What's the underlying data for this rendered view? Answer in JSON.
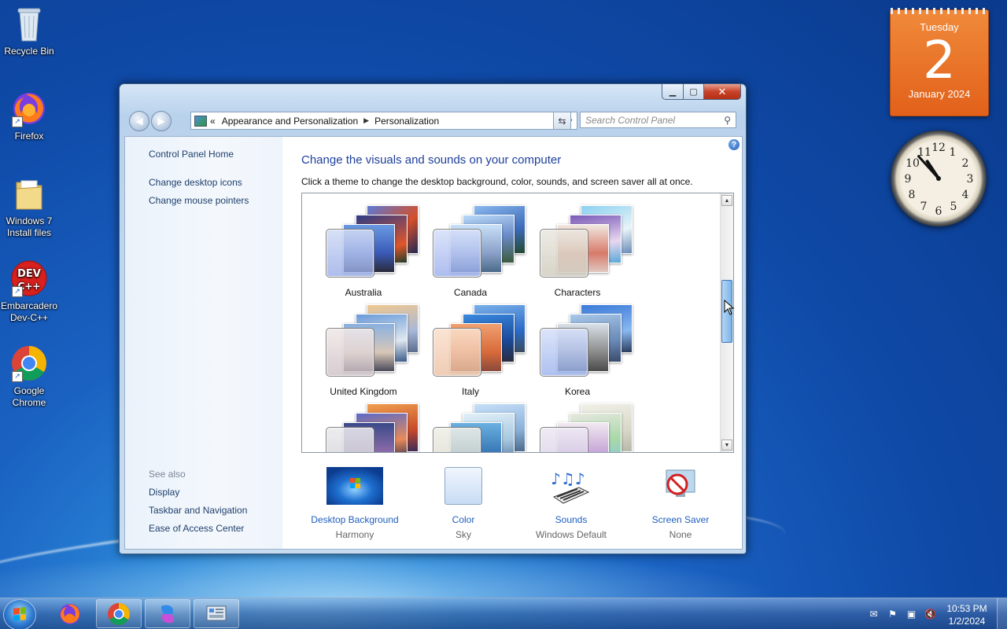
{
  "desktop": {
    "icons": [
      {
        "label": "Recycle Bin"
      },
      {
        "label": "Firefox"
      },
      {
        "label": "Windows 7 Install files"
      },
      {
        "label": "Embarcadero Dev-C++"
      },
      {
        "label": "Google Chrome"
      }
    ]
  },
  "calendar": {
    "day_of_week": "Tuesday",
    "day": "2",
    "month_year": "January 2024"
  },
  "clock": {
    "hour": 10,
    "minute": 53
  },
  "window": {
    "breadcrumb": {
      "prefix": "«",
      "items": [
        "Appearance and Personalization",
        "Personalization"
      ]
    },
    "search_placeholder": "Search Control Panel",
    "left_pane": {
      "home": "Control Panel Home",
      "links": [
        "Change desktop icons",
        "Change mouse pointers"
      ],
      "see_also_label": "See also",
      "see_also": [
        "Display",
        "Taskbar and Navigation",
        "Ease of Access Center"
      ]
    },
    "heading": "Change the visuals and sounds on your computer",
    "subtext": "Click a theme to change the desktop background, color, sounds, and screen saver all at once.",
    "themes": [
      {
        "name": "Australia"
      },
      {
        "name": "Canada"
      },
      {
        "name": "Characters"
      },
      {
        "name": "United Kingdom"
      },
      {
        "name": "Italy"
      },
      {
        "name": "Korea"
      },
      {
        "name": ""
      },
      {
        "name": ""
      },
      {
        "name": ""
      }
    ],
    "bottom": [
      {
        "label": "Desktop Background",
        "value": "Harmony"
      },
      {
        "label": "Color",
        "value": "Sky"
      },
      {
        "label": "Sounds",
        "value": "Windows Default"
      },
      {
        "label": "Screen Saver",
        "value": "None"
      }
    ]
  },
  "taskbar": {
    "apps": [
      "firefox",
      "chrome",
      "copilot",
      "control-panel"
    ],
    "time": "10:53 PM",
    "date": "1/2/2024"
  }
}
